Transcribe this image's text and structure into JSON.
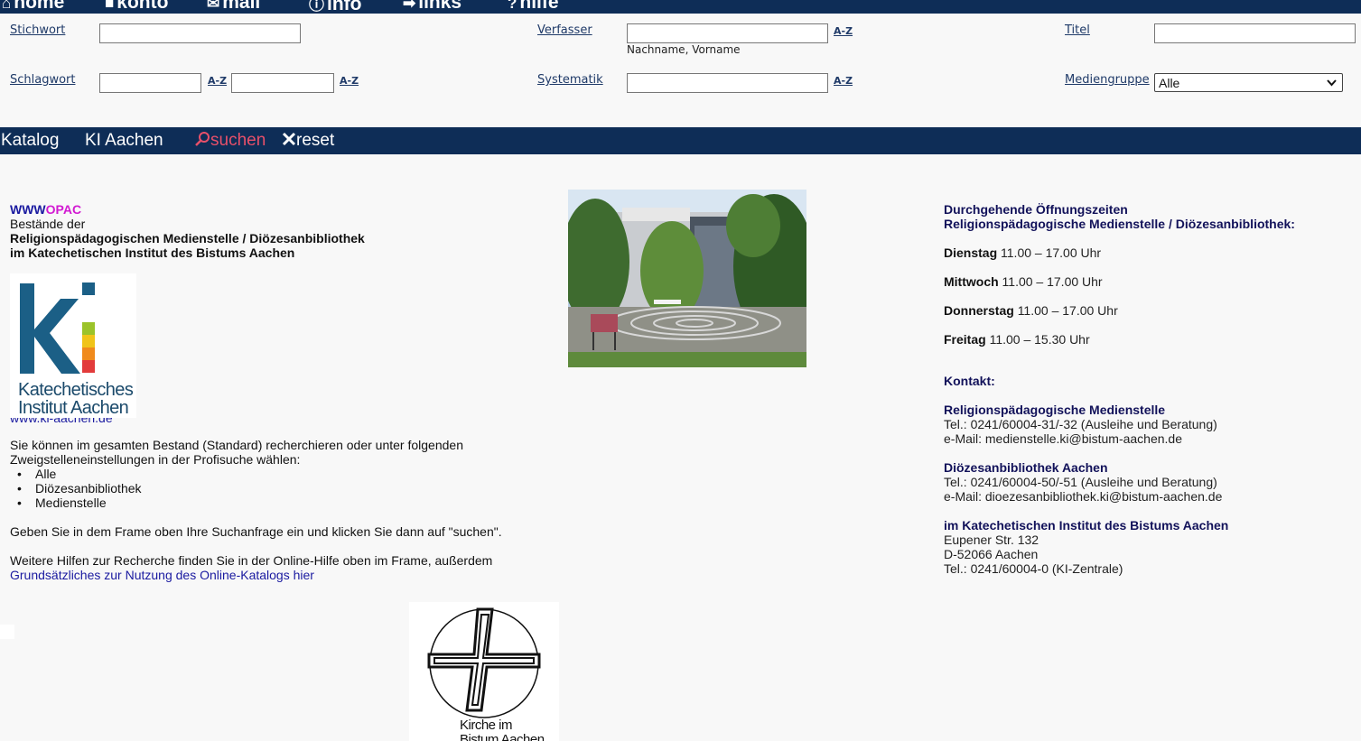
{
  "nav": {
    "items": [
      {
        "icon": "home-icon",
        "glyph": "⌂",
        "label": "home"
      },
      {
        "icon": "account-icon",
        "glyph": "■",
        "label": "konto"
      },
      {
        "icon": "mail-icon",
        "glyph": "✉",
        "label": "mail"
      },
      {
        "icon": "info-icon",
        "glyph": "ⓘ",
        "label": "info"
      },
      {
        "icon": "arrow-right-icon",
        "glyph": "➡",
        "label": "links"
      },
      {
        "icon": "help-icon",
        "glyph": "?",
        "label": "hilfe"
      }
    ]
  },
  "form": {
    "stichwort_label": "Stichwort",
    "verfasser_label": "Verfasser",
    "verfasser_hint": "Nachname, Vorname",
    "titel_label": "Titel",
    "schlagwort_label": "Schlagwort",
    "systematik_label": "Systematik",
    "mediengruppe_label": "Mediengruppe",
    "mediengruppe_value": "Alle",
    "az_label": "A-Z"
  },
  "searchbar": {
    "katalog": "Katalog",
    "ki_aachen": "KI Aachen",
    "suchen": "suchen",
    "reset": "reset"
  },
  "left": {
    "www": "WWW",
    "opac": "OPAC",
    "bestaende": "Bestände der",
    "line1": "Religionspädagogischen Medienstelle / Diözesanbibliothek",
    "line2": "im Katechetischen Institut des Bistums Aachen",
    "logo_text1": "Katechetisches",
    "logo_text2": "Institut Aachen",
    "website": "www.ki-aachen.de",
    "intro": "Sie können im gesamten Bestand (Standard) recherchieren oder unter folgenden Zweigstelleneinstellungen in der Profisuche wählen:",
    "branches": [
      "Alle",
      "Diözesanbibliothek",
      "Medienstelle"
    ],
    "instruction": "Geben Sie in dem Frame oben Ihre Suchanfrage ein und klicken Sie dann auf \"suchen\".",
    "help_text": "Weitere Hilfen zur Recherche finden Sie in der Online-Hilfe oben im Frame, außerdem",
    "help_link": "Grundsätzliches zur Nutzung des Online-Katalogs hier"
  },
  "right": {
    "hours_title1": "Durchgehende Öffnungszeiten",
    "hours_title2": "Religionspädagogische Medienstelle / Diözesanbibliothek:",
    "hours": [
      {
        "day": "Dienstag",
        "time": "11.00 – 17.00 Uhr"
      },
      {
        "day": "Mittwoch",
        "time": "11.00 – 17.00 Uhr"
      },
      {
        "day": "Donnerstag",
        "time": "11.00 – 17.00 Uhr"
      },
      {
        "day": "Freitag",
        "time": "11.00 – 15.30 Uhr"
      }
    ],
    "kontakt": "Kontakt:",
    "medienstelle_title": "Religionspädagogische Medienstelle",
    "medienstelle_tel": "Tel.: 0241/60004-31/-32 (Ausleihe und Beratung)",
    "medienstelle_mail": "e-Mail: medienstelle.ki@bistum-aachen.de",
    "dioezesan_title": "Diözesanbibliothek Aachen",
    "dioezesan_tel": "Tel.: 0241/60004-50/-51 (Ausleihe und Beratung)",
    "dioezesan_mail": "e-Mail: dioezesanbibliothek.ki@bistum-aachen.de",
    "institut_title": "im Katechetischen Institut des Bistums Aachen",
    "street": "Eupener Str. 132",
    "city": "D-52066 Aachen",
    "tel": "Tel.: 0241/60004-0 (KI-Zentrale)"
  },
  "bottom_logo": {
    "line1": "Kirche im",
    "line2": "Bistum Aachen"
  },
  "colors": {
    "navy": "#0e2d57",
    "link": "#1a1aa0",
    "opac": "#d21ad2",
    "suchen": "#e8506a"
  }
}
